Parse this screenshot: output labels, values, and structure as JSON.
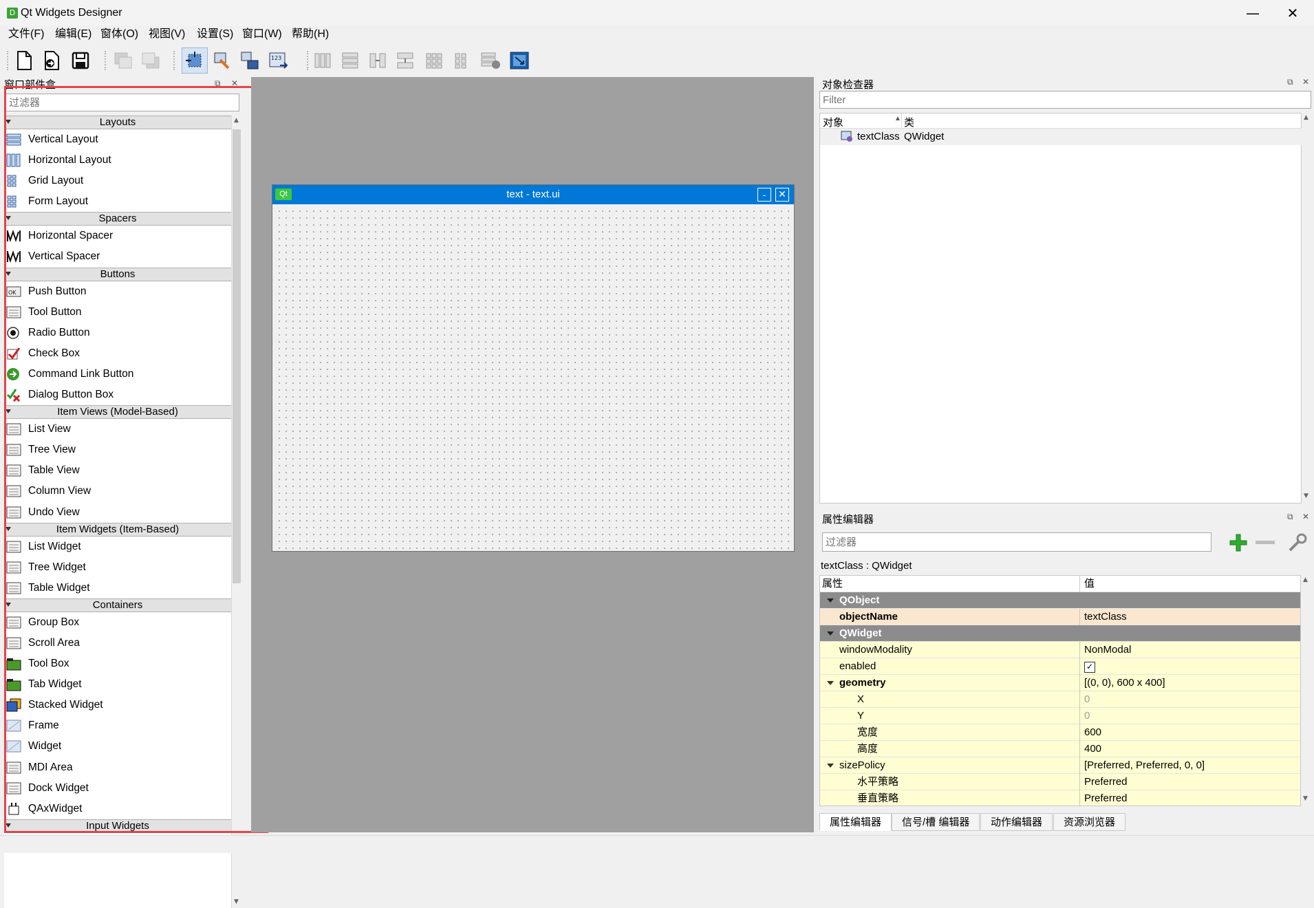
{
  "window": {
    "title": "Qt Widgets Designer",
    "icon_letter": "D",
    "minimize": "—",
    "maximize": "☐",
    "close": "✕"
  },
  "menu": [
    "文件(F)",
    "编辑(E)",
    "窗体(O)",
    "视图(V)",
    "设置(S)",
    "窗口(W)",
    "帮助(H)"
  ],
  "toolbar_icons": [
    "new-file-icon",
    "open-file-icon",
    "save-icon",
    "bring-to-front-icon",
    "send-to-back-icon",
    "edit-widgets-icon",
    "edit-signals-slots-icon",
    "edit-buddies-icon",
    "edit-tab-order-icon",
    "layout-horizontal-icon",
    "layout-vertical-icon",
    "layout-horizontal-splitter-icon",
    "layout-vertical-splitter-icon",
    "layout-grid-icon",
    "layout-form-icon",
    "break-layout-icon",
    "adjust-size-icon"
  ],
  "widget_box": {
    "title": "窗口部件盒",
    "filter_placeholder": "过滤器",
    "categories": [
      {
        "name": "Layouts",
        "items": [
          "Vertical Layout",
          "Horizontal Layout",
          "Grid Layout",
          "Form Layout"
        ]
      },
      {
        "name": "Spacers",
        "items": [
          "Horizontal Spacer",
          "Vertical Spacer"
        ]
      },
      {
        "name": "Buttons",
        "items": [
          "Push Button",
          "Tool Button",
          "Radio Button",
          "Check Box",
          "Command Link Button",
          "Dialog Button Box"
        ]
      },
      {
        "name": "Item Views (Model-Based)",
        "items": [
          "List View",
          "Tree View",
          "Table View",
          "Column View",
          "Undo View"
        ]
      },
      {
        "name": "Item Widgets (Item-Based)",
        "items": [
          "List Widget",
          "Tree Widget",
          "Table Widget"
        ]
      },
      {
        "name": "Containers",
        "items": [
          "Group Box",
          "Scroll Area",
          "Tool Box",
          "Tab Widget",
          "Stacked Widget",
          "Frame",
          "Widget",
          "MDI Area",
          "Dock Widget",
          "QAxWidget"
        ]
      },
      {
        "name": "Input Widgets",
        "items": []
      }
    ]
  },
  "form": {
    "title": "text - text.ui",
    "qt_badge": "Qt",
    "min": "-",
    "close": "✕"
  },
  "object_inspector": {
    "title": "对象检查器",
    "filter_placeholder": "Filter",
    "col_object": "对象",
    "col_class": "类",
    "row": {
      "object": "textClass",
      "class": "QWidget"
    }
  },
  "property_editor": {
    "title": "属性编辑器",
    "filter_placeholder": "过滤器",
    "class_label": "textClass : QWidget",
    "col_property": "属性",
    "col_value": "值",
    "rows": [
      {
        "k": "QObject",
        "v": "",
        "type": "grp"
      },
      {
        "k": "objectName",
        "v": "textClass",
        "type": "sel"
      },
      {
        "k": "QWidget",
        "v": "",
        "type": "grp"
      },
      {
        "k": "windowModality",
        "v": "NonModal",
        "type": "yel"
      },
      {
        "k": "enabled",
        "v": "✓",
        "type": "yel"
      },
      {
        "k": "geometry",
        "v": "[(0, 0), 600 x 400]",
        "type": "yel-bold"
      },
      {
        "k": "X",
        "v": "0",
        "type": "sub-dim"
      },
      {
        "k": "Y",
        "v": "0",
        "type": "sub-dim"
      },
      {
        "k": "宽度",
        "v": "600",
        "type": "sub"
      },
      {
        "k": "高度",
        "v": "400",
        "type": "sub"
      },
      {
        "k": "sizePolicy",
        "v": "[Preferred, Preferred, 0, 0]",
        "type": "yel-arrow"
      },
      {
        "k": "水平策略",
        "v": "Preferred",
        "type": "sub"
      },
      {
        "k": "垂直策略",
        "v": "Preferred",
        "type": "sub"
      }
    ],
    "tabs": [
      "属性编辑器",
      "信号/槽 编辑器",
      "动作编辑器",
      "资源浏览器"
    ]
  },
  "colors": {
    "accent": "#0078d7",
    "highlight": "#e8424b",
    "group_bg": "#8c8c8c",
    "row_yellow": "#fffdd2"
  }
}
